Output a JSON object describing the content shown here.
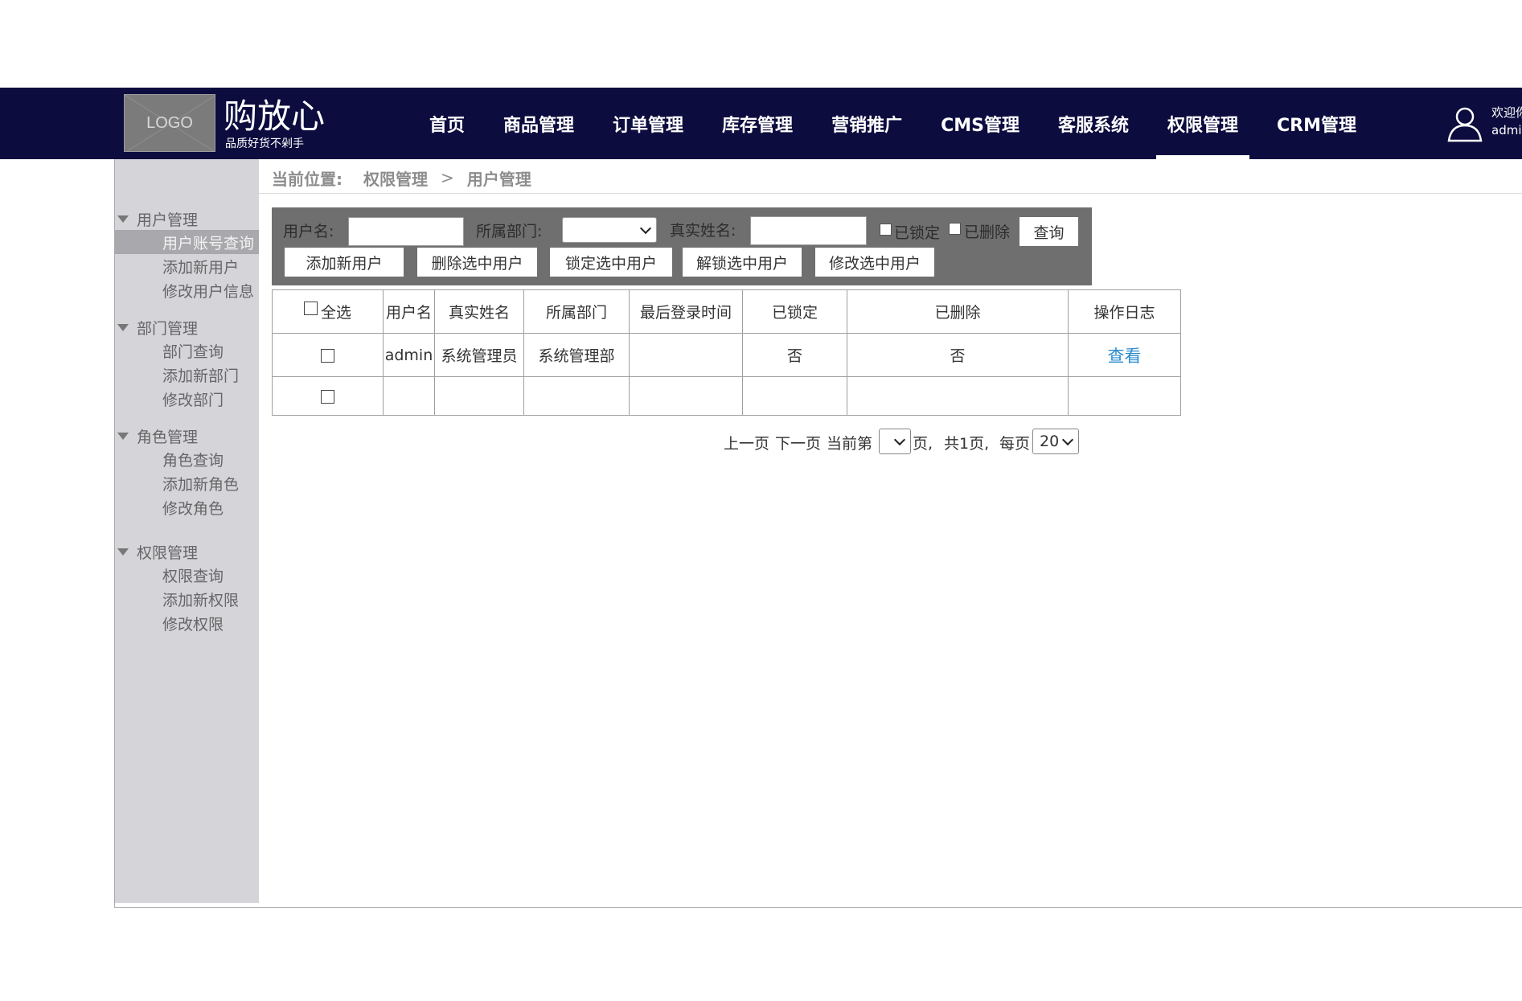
{
  "header": {
    "logo_text": "LOGO",
    "brand_name": "购放心",
    "slogan": "品质好货不剁手",
    "nav": [
      {
        "label": "首页",
        "active": false
      },
      {
        "label": "商品管理",
        "active": false
      },
      {
        "label": "订单管理",
        "active": false
      },
      {
        "label": "库存管理",
        "active": false
      },
      {
        "label": "营销推广",
        "active": false
      },
      {
        "label": "CMS管理",
        "active": false
      },
      {
        "label": "客服系统",
        "active": false
      },
      {
        "label": "权限管理",
        "active": true
      },
      {
        "label": "CRM管理",
        "active": false
      }
    ],
    "welcome_line1": "欢迎你",
    "welcome_line2": "admin",
    "user_icon": "user-icon"
  },
  "sidebar": {
    "groups": [
      {
        "title": "用户管理",
        "items": [
          "用户账号查询",
          "添加新用户",
          "修改用户信息"
        ]
      },
      {
        "title": "部门管理",
        "items": [
          "部门查询",
          "添加新部门",
          "修改部门"
        ]
      },
      {
        "title": "角色管理",
        "items": [
          "角色查询",
          "添加新角色",
          "修改角色"
        ]
      },
      {
        "title": "权限管理",
        "items": [
          "权限查询",
          "添加新权限",
          "修改权限"
        ]
      }
    ],
    "active_item": "用户账号查询"
  },
  "breadcrumb": {
    "prefix": "当前位置:",
    "level1": "权限管理",
    "separator": ">",
    "level2": "用户管理"
  },
  "search": {
    "username_label": "用户名:",
    "username_value": "",
    "dept_label": "所属部门:",
    "dept_value": "",
    "realname_label": "真实姓名:",
    "realname_value": "",
    "locked_label": "已锁定",
    "deleted_label": "已删除",
    "query_button": "查询",
    "actions": [
      "添加新用户",
      "删除选中用户",
      "锁定选中用户",
      "解锁选中用户",
      "修改选中用户"
    ]
  },
  "table": {
    "select_all_label": "全选",
    "columns": [
      "用户名",
      "真实姓名",
      "所属部门",
      "最后登录时间",
      "已锁定",
      "已删除",
      "操作日志"
    ],
    "rows": [
      {
        "username": "admin",
        "realname": "系统管理员",
        "dept": "系统管理部",
        "last_login": "",
        "locked": "否",
        "deleted": "否",
        "log": "查看"
      },
      {
        "username": "",
        "realname": "",
        "dept": "",
        "last_login": "",
        "locked": "",
        "deleted": "",
        "log": ""
      }
    ]
  },
  "pager": {
    "prev": "上一页",
    "next": "下一页",
    "current_label": "当前第",
    "current_page": "",
    "page_unit": "页,",
    "total": "共1页,",
    "per_page_label": "每页",
    "per_page_value": "20"
  },
  "colors": {
    "header_bg": "#0c0c3f",
    "sidebar_bg": "#d4d4d9",
    "search_panel_bg": "#6f6f6f",
    "link": "#2b8ccf"
  }
}
